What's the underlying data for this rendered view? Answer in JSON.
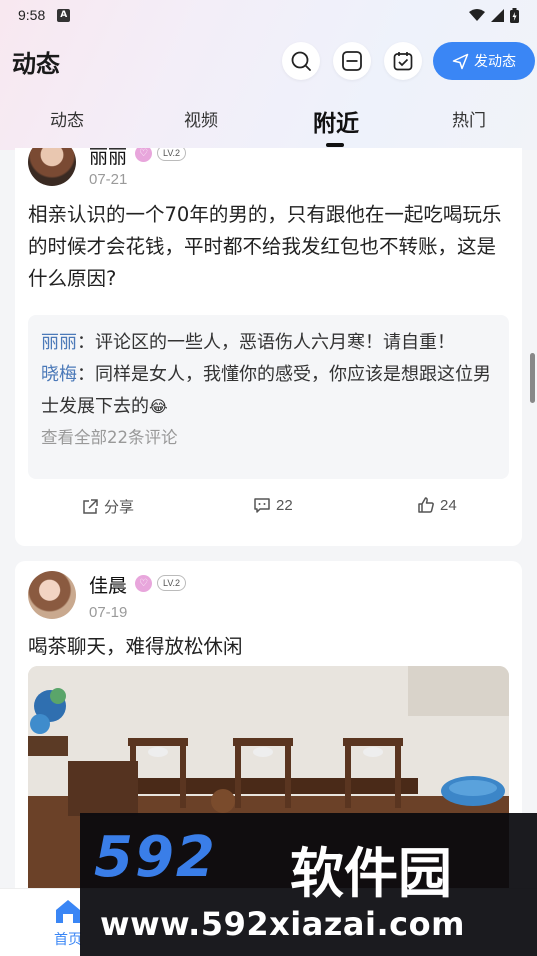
{
  "status_bar": {
    "time": "9:58",
    "badge": "A"
  },
  "header": {
    "title": "动态",
    "icons": [
      "search-icon",
      "scan-icon",
      "calendar-check-icon"
    ],
    "post_label": "发动态"
  },
  "tabs": [
    {
      "label": "动态"
    },
    {
      "label": "视频"
    },
    {
      "label": "附近",
      "active": true
    },
    {
      "label": "热门"
    }
  ],
  "posts": [
    {
      "username": "丽丽",
      "level": "LV.2",
      "date": "07-21",
      "text": "相亲认识的一个70年的男的，只有跟他在一起吃喝玩乐的时候才会花钱，平时都不给我发红包也不转账，这是什么原因?",
      "comments": [
        {
          "author": "丽丽",
          "sep": "：",
          "text": "评论区的一些人，恶语伤人六月寒！请自重！"
        },
        {
          "author": "晓梅",
          "sep": "：",
          "text": "同样是女人，我懂你的感受，你应该是想跟这位男士发展下去的"
        }
      ],
      "see_all": "查看全部22条评论",
      "share_label": "分享",
      "comment_count": "22",
      "like_count": "24"
    },
    {
      "username": "佳晨",
      "level": "LV.2",
      "date": "07-19",
      "text": "喝茶聊天，难得放松休闲"
    }
  ],
  "bottom_nav": {
    "home_label": "首页"
  },
  "watermark": {
    "brand_num": "592",
    "brand_text": "软件园",
    "url": "www.592xiazai.com"
  },
  "colors": {
    "accent": "#3a86f5",
    "commenter": "#4b79b8",
    "vip": "#e8a6dc"
  }
}
